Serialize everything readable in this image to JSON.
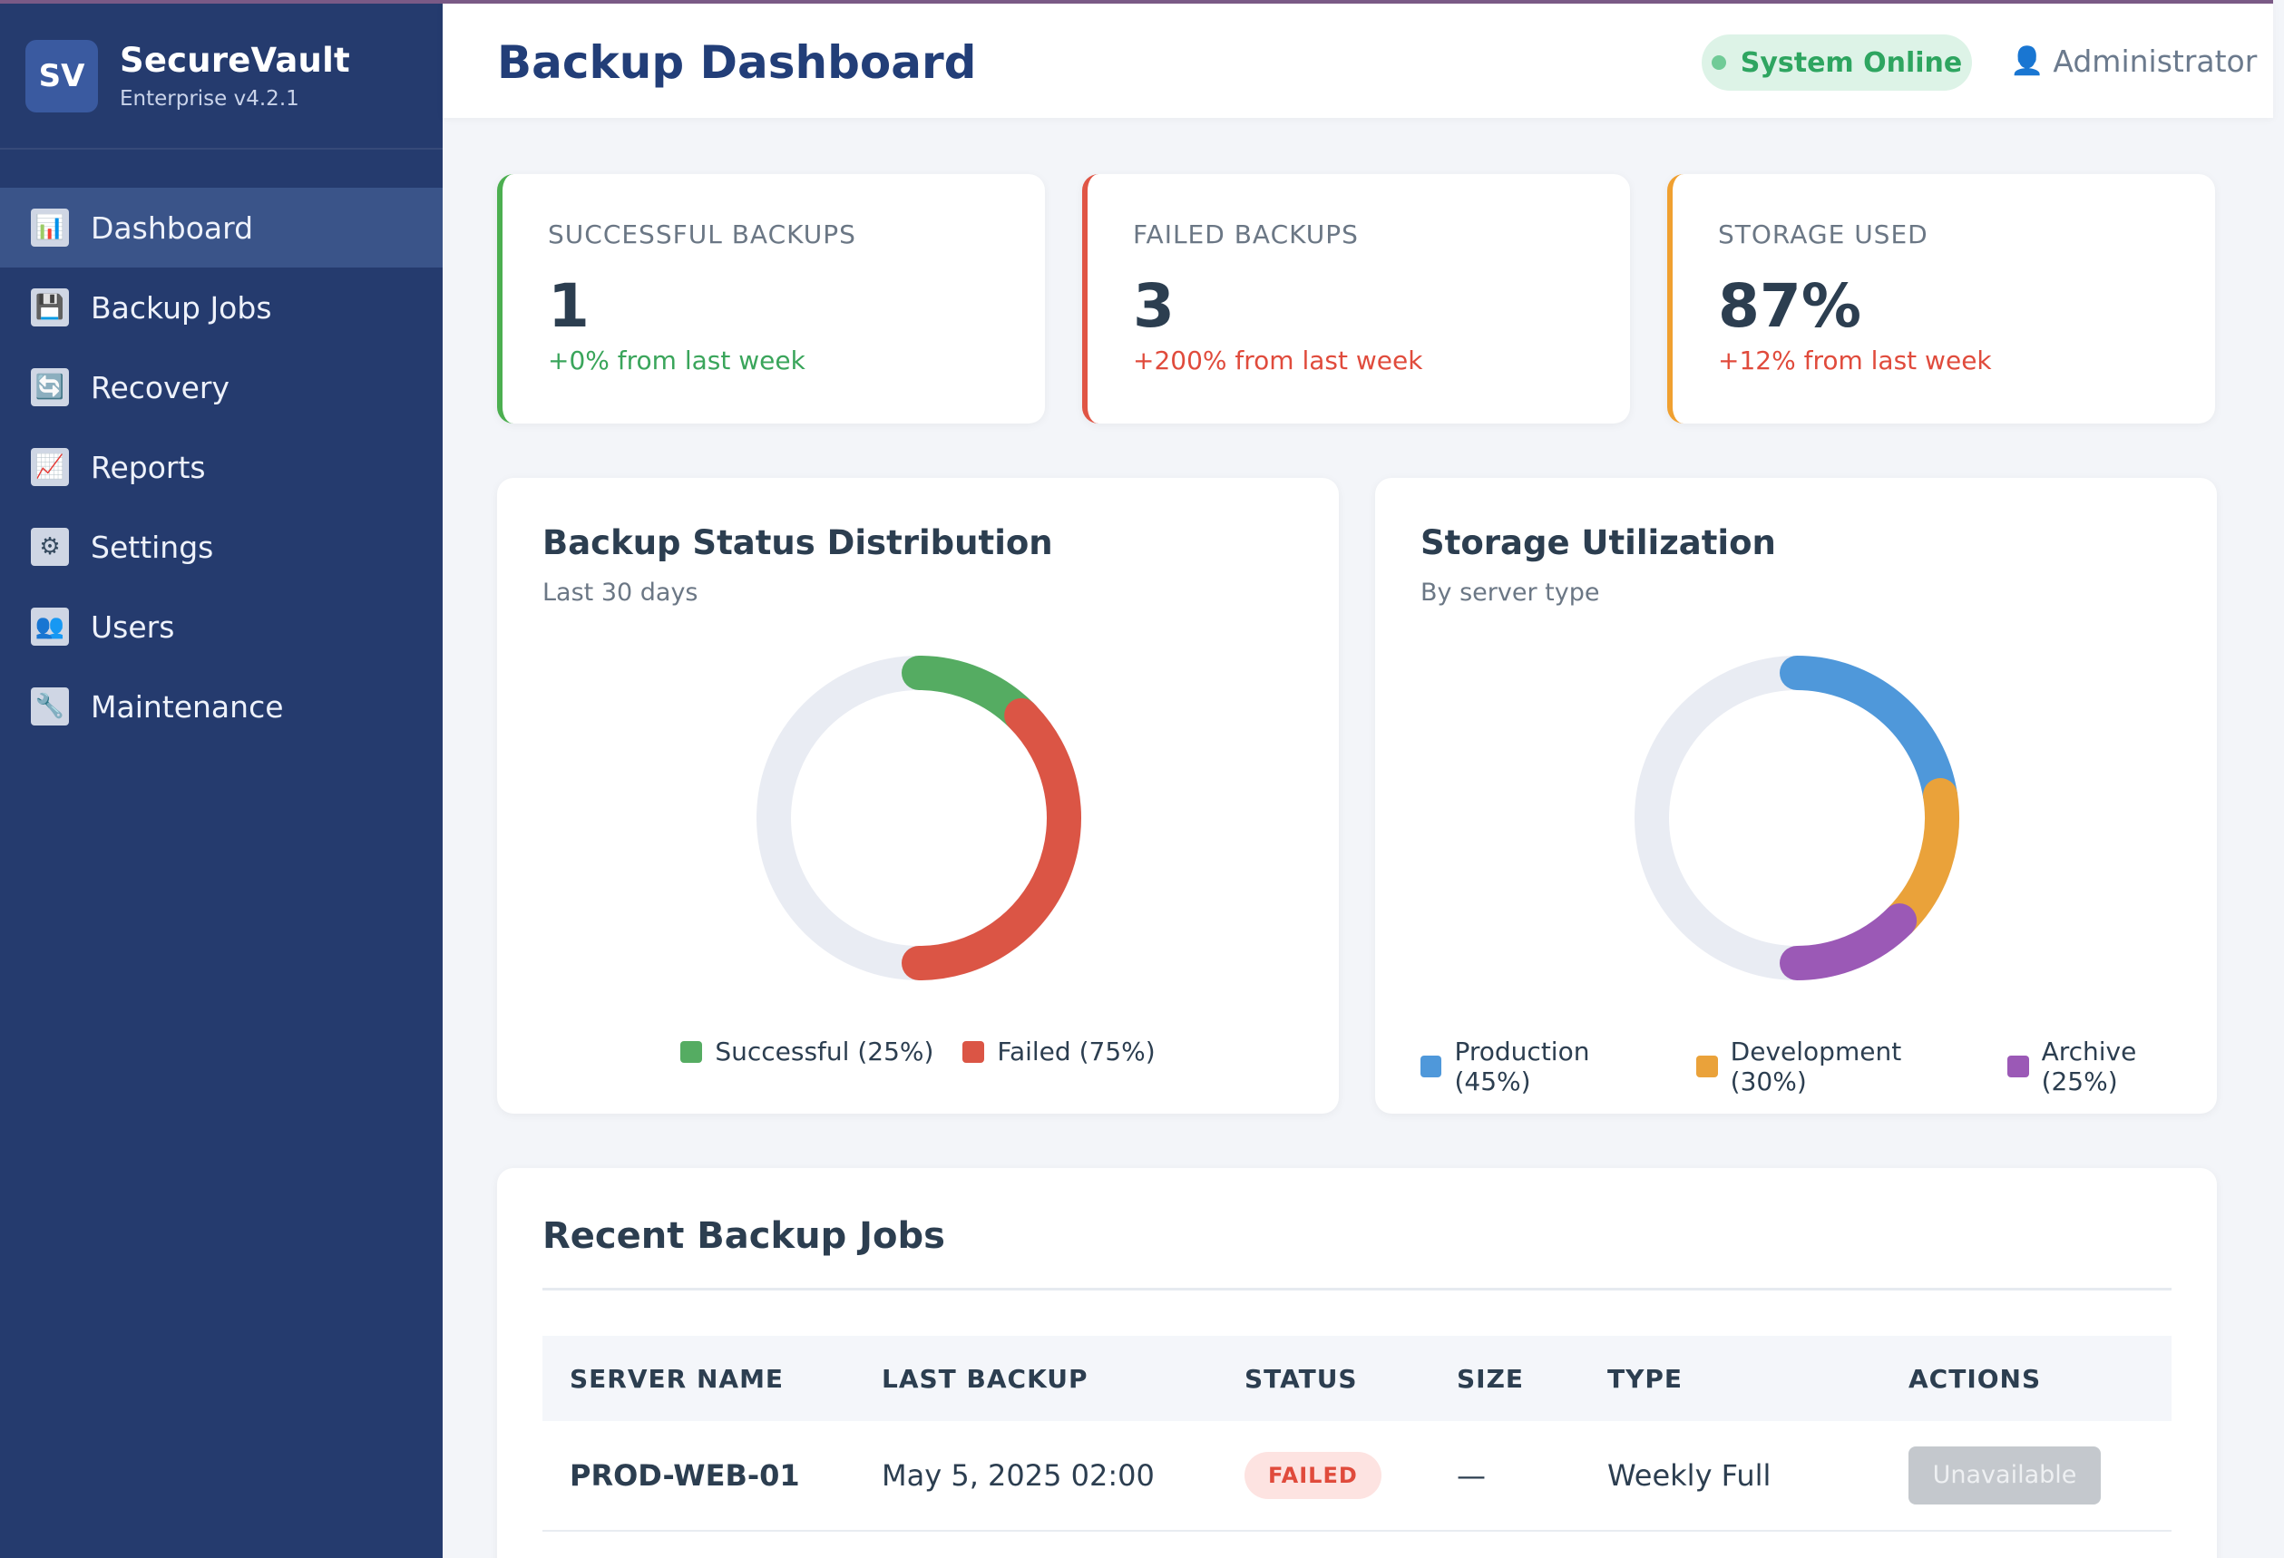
{
  "app": {
    "logo_text": "SV",
    "name": "SecureVault",
    "version": "Enterprise v4.2.1"
  },
  "nav": [
    {
      "label": "Dashboard",
      "icon": "bar-chart-icon",
      "glyph": "📊",
      "active": true
    },
    {
      "label": "Backup Jobs",
      "icon": "floppy-disk-icon",
      "glyph": "💾",
      "active": false
    },
    {
      "label": "Recovery",
      "icon": "refresh-icon",
      "glyph": "🔄",
      "active": false
    },
    {
      "label": "Reports",
      "icon": "line-chart-icon",
      "glyph": "📈",
      "active": false
    },
    {
      "label": "Settings",
      "icon": "gear-icon",
      "glyph": "⚙",
      "active": false
    },
    {
      "label": "Users",
      "icon": "users-icon",
      "glyph": "👥",
      "active": false
    },
    {
      "label": "Maintenance",
      "icon": "wrench-icon",
      "glyph": "🔧",
      "active": false
    }
  ],
  "header": {
    "title": "Backup Dashboard",
    "status": "System Online",
    "user": "Administrator"
  },
  "stats": [
    {
      "label": "SUCCESSFUL BACKUPS",
      "value": "1",
      "change": "+0% from last week",
      "accent": "#4caf50"
    },
    {
      "label": "FAILED BACKUPS",
      "value": "3",
      "change": "+200% from last week",
      "accent": "#e05545"
    },
    {
      "label": "STORAGE USED",
      "value": "87%",
      "change": "+12% from last week",
      "accent": "#f0a030"
    }
  ],
  "chart_data": [
    {
      "type": "pie",
      "title": "Backup Status Distribution",
      "subtitle": "Last 30 days",
      "categories": [
        "Successful",
        "Failed"
      ],
      "values": [
        25,
        75
      ],
      "colors": [
        "#55ac62",
        "#db5545"
      ],
      "legend": [
        "Successful (25%)",
        "Failed (75%)"
      ]
    },
    {
      "type": "pie",
      "title": "Storage Utilization",
      "subtitle": "By server type",
      "categories": [
        "Production",
        "Development",
        "Archive"
      ],
      "values": [
        45,
        30,
        25
      ],
      "colors": [
        "#4f98da",
        "#eaa23a",
        "#9b59b6"
      ],
      "legend": [
        "Production (45%)",
        "Development (30%)",
        "Archive (25%)"
      ]
    }
  ],
  "jobs": {
    "title": "Recent Backup Jobs",
    "columns": [
      "SERVER NAME",
      "LAST BACKUP",
      "STATUS",
      "SIZE",
      "TYPE",
      "ACTIONS"
    ],
    "rows": [
      {
        "server": "PROD-WEB-01",
        "last_backup": "May 5, 2025 02:00",
        "status": "FAILED",
        "size": "—",
        "type": "Weekly Full",
        "action": "Unavailable"
      }
    ]
  }
}
